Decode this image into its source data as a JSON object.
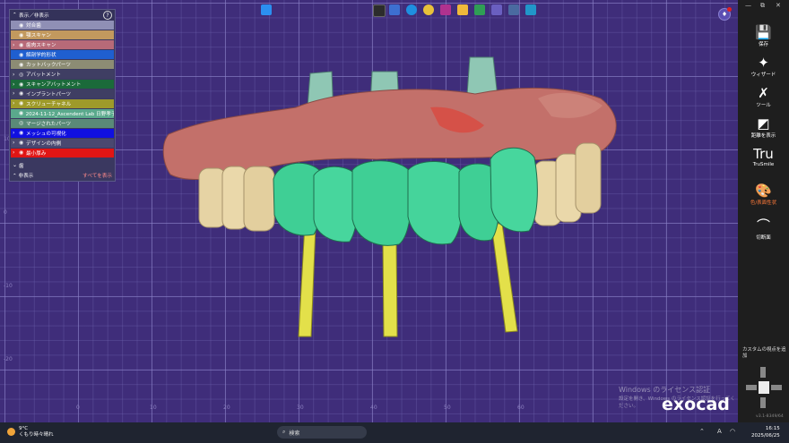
{
  "layer_panel": {
    "title": "表示／非表示",
    "help_icon": "?",
    "rows": [
      {
        "label": "対合歯",
        "color": "#8f8fb5",
        "arrow": "",
        "eye": "◉"
      },
      {
        "label": "顎スキャン",
        "color": "#c2995e",
        "arrow": "",
        "eye": "◉"
      },
      {
        "label": "歯肉スキャン",
        "color": "#b76a78",
        "arrow": "›",
        "eye": "◉"
      },
      {
        "label": "解剖学的形状",
        "color": "#1f5fd0",
        "arrow": "",
        "eye": "◉"
      },
      {
        "label": "カットバックパーツ",
        "color": "#8c8c74",
        "arrow": "",
        "eye": "◉"
      },
      {
        "label": "アバットメント",
        "color": "#3f3e63",
        "arrow": "›",
        "eye": "◎"
      },
      {
        "label": "スキャンアバットメント",
        "color": "#1b6a3a",
        "arrow": "›",
        "eye": "◉"
      },
      {
        "label": "インプラントパーツ",
        "color": "#3f3e63",
        "arrow": "›",
        "eye": "◉"
      },
      {
        "label": "スクリューチャネル",
        "color": "#9e9a2a",
        "arrow": "›",
        "eye": "◉"
      },
      {
        "label": "2024-11-12_Ascendent Lab 日野孝子",
        "color": "#5aa98c",
        "arrow": "",
        "eye": "◉"
      },
      {
        "label": "マージされたパーツ",
        "color": "#5a8a78",
        "arrow": "",
        "eye": "◎"
      },
      {
        "label": "メッシュの可視化",
        "color": "#1010e0",
        "arrow": "›",
        "eye": "◉"
      },
      {
        "label": "デザインの内側",
        "color": "#4a4870",
        "arrow": "›",
        "eye": "◉"
      },
      {
        "label": "最小厚み",
        "color": "#e01515",
        "arrow": "›",
        "eye": "◉"
      }
    ],
    "section_label": "歯",
    "footer_left": "非表示",
    "footer_right": "すべてを表示"
  },
  "sidebar": {
    "window_controls": [
      "—",
      "⧉",
      "✕"
    ],
    "items": [
      {
        "label": "保存",
        "icon": "save-icon",
        "glyph": "💾"
      },
      {
        "label": "ウィザード",
        "icon": "wand-icon",
        "glyph": "✦"
      },
      {
        "label": "ツール",
        "icon": "tools-icon",
        "glyph": "✗"
      },
      {
        "label": "距離を表示",
        "icon": "distance-icon",
        "glyph": "◩"
      },
      {
        "label": "TruSmile",
        "icon": "trusmile-icon",
        "glyph": "Tru"
      },
      {
        "label": "色/表面性状",
        "icon": "palette-icon",
        "glyph": "🎨",
        "active": true
      },
      {
        "label": "切断面",
        "icon": "tooth-section-icon",
        "glyph": "⌒"
      }
    ],
    "custom_view_label": "カスタムの視点を追加",
    "version": "v3.1-8349/64"
  },
  "viewport": {
    "notification_count": "1",
    "axis_numbers_x": [
      "0",
      "10",
      "20",
      "30",
      "40",
      "50",
      "60"
    ],
    "axis_numbers_y": [
      "10",
      "0",
      "-10",
      "-20"
    ],
    "watermark_line1": "Windows のライセンス認証",
    "watermark_line2": "設定を開き、Windows のライセンス認証を行ってください。",
    "brand": "exocad"
  },
  "taskbar": {
    "weather_temp": "9°C",
    "weather_desc": "くもり時々晴れ",
    "search_placeholder": "検索",
    "time": "16:15",
    "date": "2025/06/25",
    "ime": "A"
  },
  "colors": {
    "viewport_bg": "#3f2d7a",
    "teeth_green": "#3fcf95",
    "gum": "#c3706a",
    "abutment": "#8fc7b4",
    "implant_rod": "#e3e04a",
    "active_accent": "#ff7a3a"
  }
}
